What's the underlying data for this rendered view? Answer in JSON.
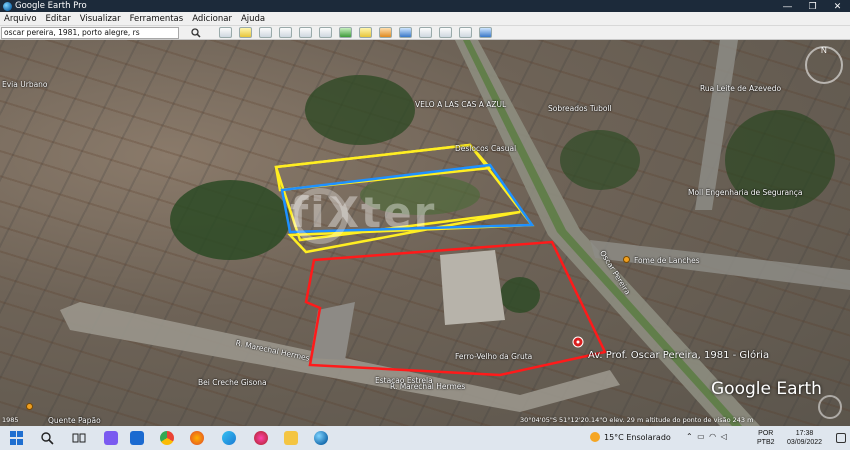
{
  "window": {
    "title": "Google Earth Pro",
    "controls": [
      "—",
      "❐",
      "✕"
    ]
  },
  "menu": {
    "items": [
      "Arquivo",
      "Editar",
      "Visualizar",
      "Ferramentas",
      "Adicionar",
      "Ajuda"
    ]
  },
  "search": {
    "value": "oscar pereira, 1981, porto alegre, rs"
  },
  "map": {
    "labels": {
      "address": "Av. Prof. Oscar Pereira, 1981 - Glória",
      "ferro_velho": "Ferro-Velho da Gruta",
      "rua_marechal_1": "R. Marechal Hermes",
      "rua_marechal_2": "R. Marechal Hermes",
      "creche": "Bei Creche Gisona",
      "quente_papao": "Quente Papão",
      "moll": "Moll Engenharia de Segurança",
      "evia": "Evia Urbano",
      "casa_azul": "VELO A LAS CAS A AZUL",
      "deslocos": "Deslocos Casual",
      "sobreaudos": "Sobreados Tuboll",
      "fome": "Fome de Lanches",
      "oscar_pereira_road": "Oscar Pereira",
      "rua_leite": "Rua Leite de Azevedo",
      "estacao": "Estacao Estrela"
    },
    "logo": "Google Earth",
    "status": "30°04'05\"S  51°12'20.14\"O  elev.  29 m   altitude do ponto de visão  243 m",
    "imagery_year": "1985",
    "watermark": "fiXter",
    "compass_n": "N",
    "colors": {
      "yellow_outline": "#ffee22",
      "blue_outline": "#1e90ff",
      "red_outline": "#ff1a1a"
    }
  },
  "taskbar": {
    "weather_temp": "15°C",
    "weather_text": "Ensolarado",
    "lang_top": "POR",
    "lang_bottom": "PTB2",
    "time": "17:38",
    "date": "03/09/2022"
  }
}
